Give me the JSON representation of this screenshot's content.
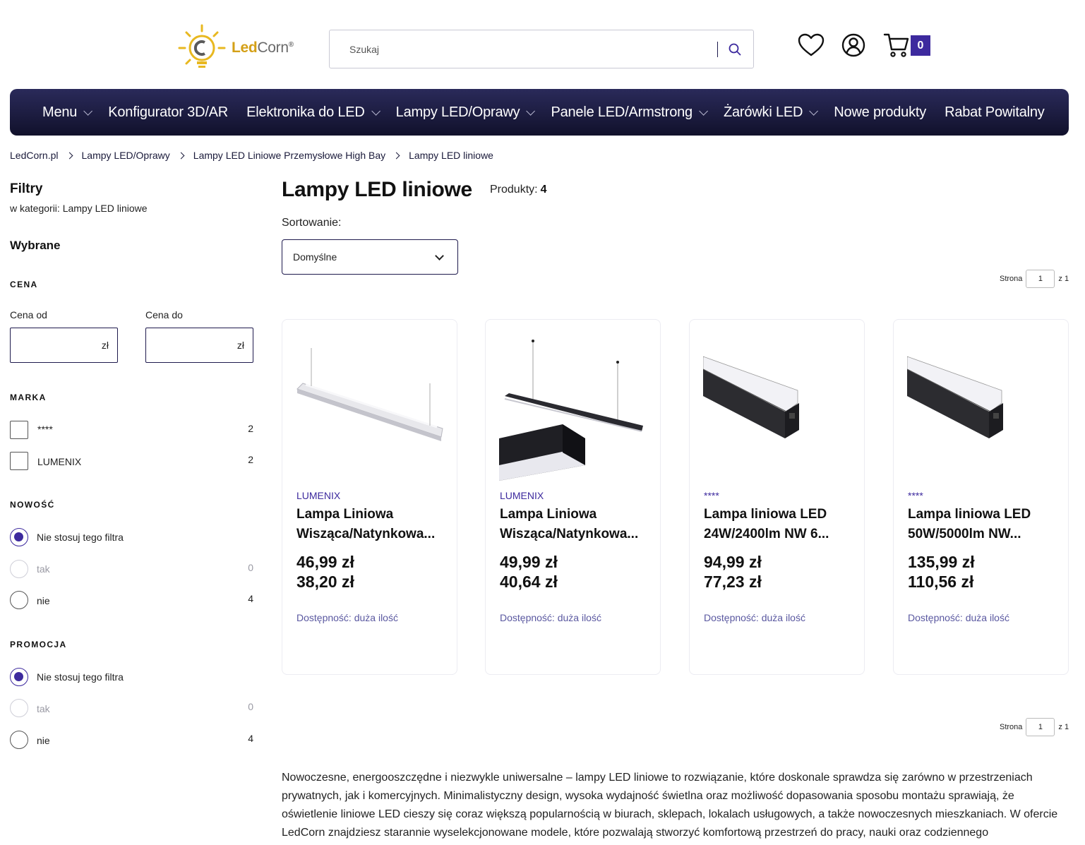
{
  "header": {
    "logo_text_a": "Led",
    "logo_text_b": "Corn",
    "logo_mark": "®",
    "search_placeholder": "Szukaj",
    "cart_count": "0"
  },
  "nav": [
    {
      "label": "Menu",
      "dropdown": true
    },
    {
      "label": "Konfigurator 3D/AR",
      "dropdown": false
    },
    {
      "label": "Elektronika do LED",
      "dropdown": true
    },
    {
      "label": "Lampy LED/Oprawy",
      "dropdown": true
    },
    {
      "label": "Panele LED/Armstrong",
      "dropdown": true
    },
    {
      "label": "Żarówki LED",
      "dropdown": true
    },
    {
      "label": "Nowe produkty",
      "dropdown": false
    },
    {
      "label": "Rabat Powitalny",
      "dropdown": false
    }
  ],
  "breadcrumb": [
    "LedCorn.pl",
    "Lampy LED/Oprawy",
    "Lampy LED Liniowe Przemysłowe High Bay",
    "Lampy LED liniowe"
  ],
  "sidebar": {
    "title": "Filtry",
    "subtitle": "w kategorii: Lampy LED liniowe",
    "selected_title": "Wybrane",
    "price": {
      "heading": "CENA",
      "from_label": "Cena od",
      "to_label": "Cena do",
      "currency": "zł"
    },
    "brand": {
      "heading": "MARKA",
      "options": [
        {
          "label": "****",
          "count": "2"
        },
        {
          "label": "LUMENIX",
          "count": "2"
        }
      ]
    },
    "new": {
      "heading": "NOWOŚĆ",
      "options": [
        {
          "label": "Nie stosuj tego filtra",
          "count": ""
        },
        {
          "label": "tak",
          "count": "0"
        },
        {
          "label": "nie",
          "count": "4"
        }
      ]
    },
    "promo": {
      "heading": "PROMOCJA",
      "options": [
        {
          "label": "Nie stosuj tego filtra",
          "count": ""
        },
        {
          "label": "tak",
          "count": "0"
        },
        {
          "label": "nie",
          "count": "4"
        }
      ]
    }
  },
  "main": {
    "title": "Lampy LED liniowe",
    "count_label": "Produkty:",
    "count_value": "4",
    "sort_label": "Sortowanie:",
    "sort_value": "Domyślne",
    "pager": {
      "label": "Strona",
      "value": "1",
      "of": "z 1"
    }
  },
  "products": [
    {
      "brand": "LUMENIX",
      "name_1": "Lampa Liniowa",
      "name_2": "Wisząca/Natynkowa...",
      "price_old": "46,99 zł",
      "price_new": "38,20 zł",
      "availability": "Dostępność: duża ilość"
    },
    {
      "brand": "LUMENIX",
      "name_1": "Lampa Liniowa",
      "name_2": "Wisząca/Natynkowa...",
      "price_old": "49,99 zł",
      "price_new": "40,64 zł",
      "availability": "Dostępność: duża ilość"
    },
    {
      "brand": "****",
      "name_1": "Lampa liniowa LED",
      "name_2": "24W/2400lm NW 6...",
      "price_old": "94,99 zł",
      "price_new": "77,23 zł",
      "availability": "Dostępność: duża ilość"
    },
    {
      "brand": "****",
      "name_1": "Lampa liniowa LED",
      "name_2": "50W/5000lm NW...",
      "price_old": "135,99 zł",
      "price_new": "110,56 zł",
      "availability": "Dostępność: duża ilość"
    }
  ],
  "description": "Nowoczesne, energooszczędne i niezwykle uniwersalne – lampy LED liniowe to rozwiązanie, które doskonale sprawdza się zarówno w przestrzeniach prywatnych, jak i komercyjnych. Minimalistyczny design, wysoka wydajność świetlna oraz możliwość dopasowania sposobu montażu sprawiają, że oświetlenie liniowe LED cieszy się coraz większą popularnością w biurach, sklepach, lokalach usługowych, a także nowoczesnych mieszkaniach. W ofercie LedCorn znajdziesz starannie wyselekcjonowane modele, które pozwalają stworzyć komfortową przestrzeń do pracy, nauki oraz codziennego",
  "colors": {
    "nav_bg": "#1a1a3e",
    "accent": "#3d2a9e",
    "brand_gold": "#d4a017"
  }
}
